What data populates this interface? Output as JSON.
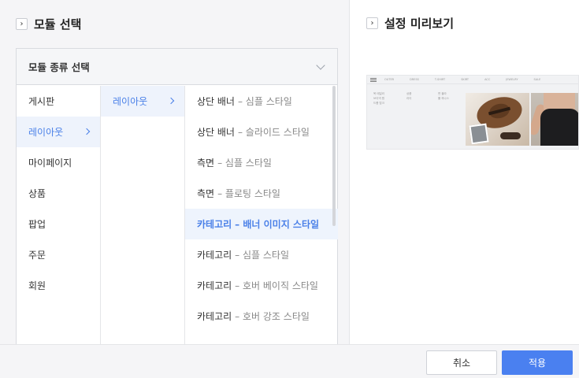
{
  "left_panel": {
    "title": "모듈 선택",
    "chevron_icon": "chevron-right-icon"
  },
  "module_selector": {
    "header": "모듈 종류 선택",
    "header_icon": "chevron-down-icon",
    "categories": [
      {
        "label": "게시판",
        "active": false
      },
      {
        "label": "레이아웃",
        "active": true
      },
      {
        "label": "마이페이지",
        "active": false
      },
      {
        "label": "상품",
        "active": false
      },
      {
        "label": "팝업",
        "active": false
      },
      {
        "label": "주문",
        "active": false
      },
      {
        "label": "회원",
        "active": false
      }
    ],
    "subcategories": [
      {
        "label": "레이아웃",
        "active": true
      }
    ],
    "modules": [
      {
        "name": "상단 배너",
        "style": "– 심플 스타일",
        "active": false
      },
      {
        "name": "상단 배너",
        "style": "– 슬라이드 스타일",
        "active": false
      },
      {
        "name": "측면",
        "style": "– 심플 스타일",
        "active": false
      },
      {
        "name": "측면",
        "style": "– 플로팅 스타일",
        "active": false
      },
      {
        "name": "카테고리",
        "style": "– 배너 이미지 스타일",
        "active": true
      },
      {
        "name": "카테고리",
        "style": "– 심플 스타일",
        "active": false
      },
      {
        "name": "카테고리",
        "style": "– 호버 베이직 스타일",
        "active": false
      },
      {
        "name": "카테고리",
        "style": "– 호버 강조 스타일",
        "active": false
      }
    ]
  },
  "preview_panel": {
    "title": "설정 미리보기",
    "chevron_icon": "chevron-right-icon",
    "nav_items": [
      "OUTER",
      "DRESS",
      "T-SHIRT",
      "SKIRT",
      "ACC",
      "JEWELRY",
      "SALE"
    ],
    "col_a": [
      "목 테일러",
      "브이넥 원",
      "드롭 탑크"
    ],
    "col_b": [
      "상품",
      "라이"
    ],
    "col_c": [
      "면 블라",
      "롤 하나스"
    ]
  },
  "footer": {
    "cancel_label": "취소",
    "apply_label": "적용"
  },
  "colors": {
    "accent": "#4a80f0",
    "active_bg": "#eef3fc"
  }
}
